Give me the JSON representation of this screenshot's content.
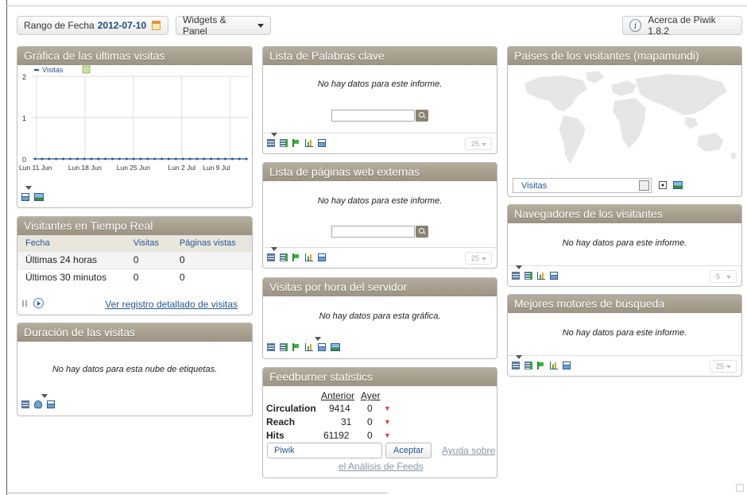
{
  "toolbar": {
    "date_label": "Rango de Fecha",
    "date_value": "2012-07-10",
    "widgets_label": "Widgets & Panel",
    "about_label": "Acerca de Piwik 1.8.2"
  },
  "evolution": {
    "title": "Gráfica de las últimas visitas",
    "legend": "Visitas",
    "chart_data": {
      "type": "line",
      "series": [
        {
          "name": "Visitas",
          "values": [
            0,
            0,
            0,
            0,
            0,
            0,
            0,
            0,
            0,
            0,
            0,
            0,
            0,
            0,
            0,
            0,
            0,
            0,
            0,
            0,
            0,
            0,
            0,
            0,
            0,
            0,
            0,
            0,
            0,
            0,
            0
          ]
        }
      ],
      "ylim": [
        0,
        2
      ],
      "yticks": [
        "0",
        "1",
        "2"
      ],
      "xticks": [
        "Lun 11 Jun",
        "Lun 18 Jun",
        "Lun 25 Jun",
        "Lun 2 Jul",
        "Lun 9 Jul"
      ],
      "grid": true
    }
  },
  "realtime": {
    "title": "Visitantes en Tiempo Real",
    "columns": [
      "Fecha",
      "Visitas",
      "Páginas vistas"
    ],
    "rows": [
      [
        "Últimas 24 horas",
        "0",
        "0"
      ],
      [
        "Últimos 30 minutos",
        "0",
        "0"
      ]
    ],
    "log_link": "Ver registro detallado de visitas"
  },
  "duration": {
    "title": "Duración de las visitas",
    "message": "No hay datos para esta nube de etiquetas."
  },
  "keywords": {
    "title": "Lista de Palabras clave",
    "message": "No hay datos para este informe.",
    "limit": "25"
  },
  "outlinks": {
    "title": "Lista de páginas web externas",
    "message": "No hay datos para este informe.",
    "limit": "25"
  },
  "hourly": {
    "title": "Visitas por hora del servidor",
    "message": "No hay datos para esta gráfica."
  },
  "feedburner": {
    "title": "Feedburner statistics",
    "col_prev": "Anterior",
    "col_yest": "Ayer",
    "rows": [
      {
        "label": "Circulation",
        "prev": "9414",
        "yest": "0"
      },
      {
        "label": "Reach",
        "prev": "31",
        "yest": "0"
      },
      {
        "label": "Hits",
        "prev": "61192",
        "yest": "0"
      }
    ],
    "input_value": "Piwik",
    "accept": "Aceptar",
    "help_1": "Ayuda sobre",
    "help_2": "el Análisis de Feeds"
  },
  "countries": {
    "title": "Países de los visitantes (mapamundi)",
    "metric": "Visitas"
  },
  "browsers": {
    "title": "Navegadores de los visitantes",
    "message": "No hay datos para este informe.",
    "limit": "5"
  },
  "search_engines": {
    "title": "Mejores motores de búsqueda",
    "message": "No hay datos para este informe.",
    "limit": "25"
  }
}
